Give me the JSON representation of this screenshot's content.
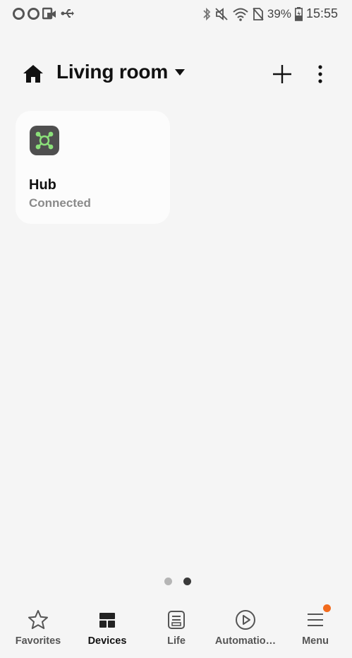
{
  "status_bar": {
    "battery": "39%",
    "time": "15:55"
  },
  "header": {
    "title": "Living room"
  },
  "devices": [
    {
      "name": "Hub",
      "status": "Connected"
    }
  ],
  "pagination": {
    "pages": 2,
    "current": 2
  },
  "bottom_nav": {
    "items": [
      {
        "label": "Favorites",
        "icon": "star-icon"
      },
      {
        "label": "Devices",
        "icon": "devices-grid-icon"
      },
      {
        "label": "Life",
        "icon": "life-icon"
      },
      {
        "label": "Automatio…",
        "icon": "play-circle-icon"
      },
      {
        "label": "Menu",
        "icon": "menu-icon"
      }
    ],
    "active": "Devices"
  },
  "colors": {
    "background": "#f5f5f5",
    "card": "#fcfcfc",
    "hub_icon_bg": "#4f4f4f",
    "hub_icon_accent": "#8be07a",
    "badge": "#f26b1d"
  }
}
